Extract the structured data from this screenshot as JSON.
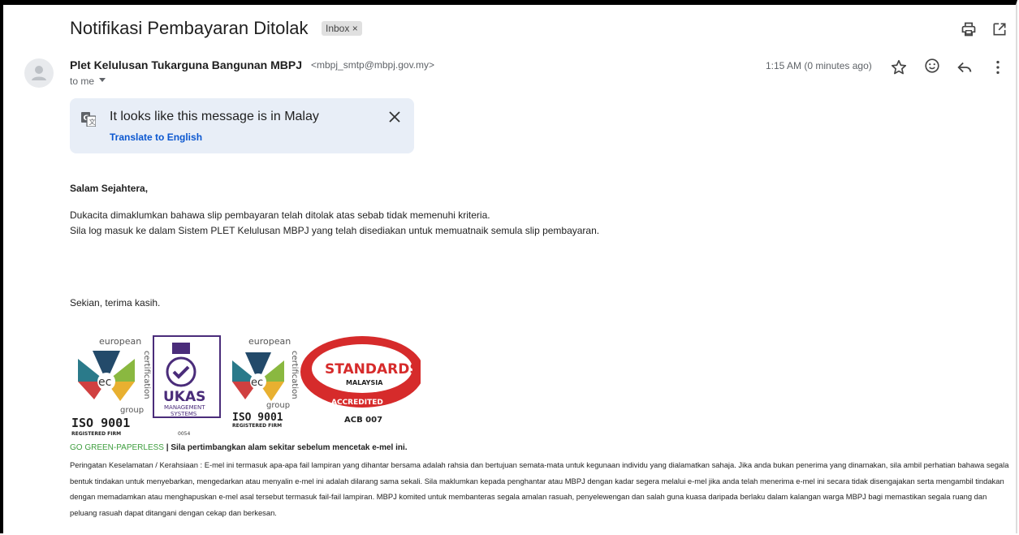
{
  "email": {
    "subject": "Notifikasi Pembayaran Ditolak",
    "label": "Inbox ×",
    "sender_name": "Plet Kelulusan Tukarguna Bangunan MBPJ",
    "sender_email": "<mbpj_smtp@mbpj.gov.my>",
    "recipient": "to me",
    "time": "1:15 AM (0 minutes ago)"
  },
  "translate": {
    "message": "It looks like this message is in Malay",
    "action": "Translate to English"
  },
  "body": {
    "greeting": "Salam Sejahtera,",
    "paragraph1": "Dukacita dimaklumkan bahawa slip pembayaran telah ditolak atas sebab tidak memenuhi kriteria.",
    "paragraph2": "Sila log masuk ke dalam Sistem PLET Kelulusan MBPJ yang telah disediakan untuk memuatnaik semula slip pembayaran.",
    "closing": "Sekian, terima kasih."
  },
  "logos": {
    "ec1_top": "european",
    "ec1_side": "certification",
    "ec1_group": "group",
    "iso1": "ISO 9001",
    "iso1_sub": "REGISTERED FIRM",
    "ukas": "UKAS",
    "ukas_sub1": "MANAGEMENT",
    "ukas_sub2": "SYSTEMS",
    "ukas_num": "0054",
    "ec2_top": "european",
    "ec2_side": "certification",
    "ec2_group": "group",
    "iso2": "ISO 9001",
    "iso2_sub": "REGISTERED FIRM",
    "standards": "STANDARDS",
    "malaysia": "MALAYSIA",
    "accredited": "ACCREDITED",
    "acb": "ACB 007"
  },
  "footer": {
    "green": "GO GREEN-PAPERLESS",
    "separator": " | ",
    "green_note": "Sila pertimbangkan alam sekitar sebelum mencetak e-mel ini.",
    "warning": "Peringatan Keselamatan / Kerahsiaan : E-mel ini termasuk apa-apa fail lampiran yang dihantar bersama adalah rahsia dan bertujuan semata-mata untuk kegunaan individu yang dialamatkan sahaja. Jika anda bukan penerima yang dinamakan, sila ambil perhatian bahawa segala bentuk tindakan untuk menyebarkan, mengedarkan atau menyalin e-mel ini adalah dilarang sama sekali. Sila maklumkan kepada penghantar atau MBPJ dengan kadar segera melalui e-mel jika anda telah menerima e-mel ini secara tidak disengajakan serta mengambil tindakan dengan memadamkan atau menghapuskan e-mel asal tersebut termasuk fail-fail lampiran. MBPJ komited untuk membanteras segala amalan rasuah, penyelewengan dan salah guna kuasa daripada berlaku dalam kalangan warga MBPJ bagi memastikan segala ruang dan peluang rasuah dapat ditangani dengan cekap dan berkesan."
  },
  "icons": [
    "print-icon",
    "open-in-new-icon",
    "star-icon",
    "emoji-icon",
    "reply-icon",
    "more-vert-icon",
    "translate-icon",
    "close-icon",
    "avatar-icon"
  ]
}
